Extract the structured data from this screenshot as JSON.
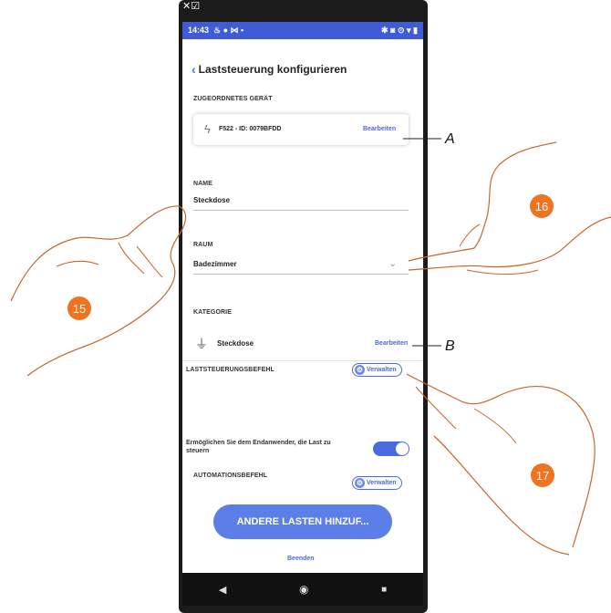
{
  "device": {
    "corner_glyph": "✕☑",
    "status_time": "14:43",
    "status_left_icons": "♨ ● ⋈ •",
    "status_right_icons": "✱ ◙ ⊙ ▾ ▮"
  },
  "screen": {
    "title": "Laststeuerung konfigurieren",
    "assigned_device": {
      "section": "ZUGEORDNETES GERÄT",
      "label": "F522 - ID: 0079BFDD",
      "edit": "Bearbeiten"
    },
    "name": {
      "section": "NAME",
      "value": "Steckdose"
    },
    "room": {
      "section": "RAUM",
      "value": "Badezimmer"
    },
    "category": {
      "section": "KATEGORIE",
      "value": "Steckdose",
      "edit": "Bearbeiten"
    },
    "load_command": {
      "section": "LASTSTEUERUNGSBEFEHL",
      "manage": "Verwalten"
    },
    "end_user_toggle": {
      "label": "Ermöglichen Sie dem Endanwender, die Last zu steuern",
      "on": true
    },
    "automation_command": {
      "section": "AUTOMATIONSBEFEHL",
      "manage": "Verwalten"
    },
    "add_button": "ANDERE LASTEN HINZUF...",
    "finish": "Beenden"
  },
  "annotations": {
    "callout_a": "A",
    "callout_b": "B",
    "step_15": "15",
    "step_16": "16",
    "step_17": "17"
  },
  "colors": {
    "accent": "#4a6ae0",
    "status_bar": "#3f5bd6",
    "badge": "#f07320"
  }
}
